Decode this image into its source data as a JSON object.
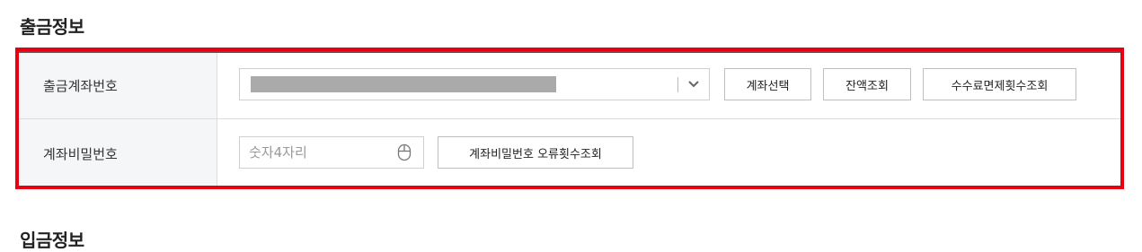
{
  "withdrawal": {
    "title": "출금정보",
    "account": {
      "label": "출금계좌번호",
      "buttons": {
        "select": "계좌선택",
        "balance": "잔액조회",
        "fee": "수수료면제횟수조회"
      }
    },
    "password": {
      "label": "계좌비밀번호",
      "placeholder": "숫자4자리",
      "error_button": "계좌비밀번호 오류횟수조회"
    }
  },
  "deposit": {
    "title": "입금정보"
  },
  "colors": {
    "highlight": "#e60012",
    "header_bg": "#f5f6f8",
    "masked": "#aaaaaa"
  },
  "icons": {
    "select_arrow": "chevron-down-icon",
    "keypad": "mouse-icon"
  }
}
